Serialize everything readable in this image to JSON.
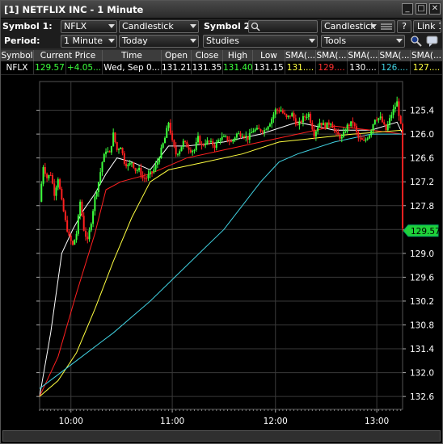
{
  "window": {
    "title": "[1] NETFLIX INC - 1 Minute",
    "buttons": [
      "_",
      "□",
      "✕"
    ]
  },
  "toolbar1": {
    "symbol1_label": "Symbol 1:",
    "symbol1_value": "NFLX",
    "chart_type": "Candlestick",
    "symbol2_label": "Symbol 2:",
    "symbol2_value": "",
    "chart_type2": "Candlestick",
    "help": "?",
    "link": "Link 1"
  },
  "toolbar2": {
    "period_label": "Period:",
    "period_value": "1 Minute",
    "range_value": "Today",
    "studies": "Studies",
    "tools": "Tools"
  },
  "quote_table": {
    "headers": [
      "Symbol",
      "Current Price",
      "Time",
      "Open",
      "Close",
      "High",
      "Low",
      "SMA(...",
      "SMA(...",
      "SMA(...",
      "SMA(...",
      "SMA(..."
    ],
    "row": [
      "NFLX",
      "129.57",
      "+4.05...",
      "Wed, Sep 0...",
      "131.21",
      "131.35",
      "131.40",
      "131.15",
      "131....",
      "129....",
      "130....",
      "126....",
      "127...."
    ],
    "colors": {
      "price": "#3cff3c",
      "high": "#3cff3c",
      "sma1": "#ffff40",
      "sma2": "#ff3030",
      "sma3": "#ffffff",
      "sma4": "#40d0e0",
      "sma5": "#ffff40"
    }
  },
  "chart": {
    "y_ticks": [
      "132.6",
      "132.0",
      "131.4",
      "130.8",
      "130.2",
      "129.6",
      "129.0",
      "128.4",
      "127.8",
      "127.2",
      "126.6",
      "126.0",
      "125.4"
    ],
    "x_ticks": [
      "10:00",
      "11:00",
      "12:00",
      "13:00"
    ],
    "last_price_label": "129.57",
    "colors": {
      "up": "#3cff3c",
      "down": "#ff2020",
      "grid": "#3a3a3a",
      "sma_white": "#ffffff",
      "sma_yellow": "#ffff40",
      "sma_red": "#ff2020",
      "sma_cyan": "#40d0e0"
    }
  },
  "chart_data": {
    "type": "candlestick",
    "title": "",
    "xlabel": "",
    "ylabel": "",
    "ylim": [
      125.2,
      133.2
    ],
    "x_ticks": [
      "10:00",
      "11:00",
      "12:00",
      "13:00"
    ],
    "y_ticks": [
      125.4,
      126.0,
      126.6,
      127.2,
      127.8,
      128.4,
      129.0,
      129.6,
      130.2,
      130.8,
      131.4,
      132.0,
      132.6
    ],
    "last_price": 129.57,
    "price_path": [
      [
        0,
        130.3
      ],
      [
        2,
        131.2
      ],
      [
        4,
        130.9
      ],
      [
        6,
        131.0
      ],
      [
        8,
        130.5
      ],
      [
        10,
        130.9
      ],
      [
        12,
        130.3
      ],
      [
        14,
        129.8
      ],
      [
        16,
        129.4
      ],
      [
        18,
        129.2
      ],
      [
        20,
        129.5
      ],
      [
        22,
        130.3
      ],
      [
        24,
        129.6
      ],
      [
        26,
        129.3
      ],
      [
        28,
        129.8
      ],
      [
        30,
        130.4
      ],
      [
        32,
        130.8
      ],
      [
        34,
        131.3
      ],
      [
        36,
        131.6
      ],
      [
        38,
        131.5
      ],
      [
        40,
        132.0
      ],
      [
        42,
        131.6
      ],
      [
        44,
        131.7
      ],
      [
        46,
        131.3
      ],
      [
        48,
        131.2
      ],
      [
        50,
        131.3
      ],
      [
        52,
        131.1
      ],
      [
        54,
        131.1
      ],
      [
        56,
        130.9
      ],
      [
        58,
        130.9
      ],
      [
        60,
        131.0
      ],
      [
        62,
        131.1
      ],
      [
        64,
        131.3
      ],
      [
        66,
        131.6
      ],
      [
        68,
        131.9
      ],
      [
        70,
        132.3
      ],
      [
        72,
        131.8
      ],
      [
        74,
        131.5
      ],
      [
        76,
        131.6
      ],
      [
        78,
        131.8
      ],
      [
        80,
        131.7
      ],
      [
        82,
        131.6
      ],
      [
        84,
        131.6
      ],
      [
        86,
        131.9
      ],
      [
        88,
        131.7
      ],
      [
        90,
        131.8
      ],
      [
        92,
        131.8
      ],
      [
        95,
        131.7
      ],
      [
        98,
        131.9
      ],
      [
        101,
        131.9
      ],
      [
        104,
        131.8
      ],
      [
        107,
        132.0
      ],
      [
        110,
        132.0
      ],
      [
        113,
        131.9
      ],
      [
        116,
        132.1
      ],
      [
        119,
        132.1
      ],
      [
        122,
        132.1
      ],
      [
        125,
        132.3
      ],
      [
        128,
        132.6
      ],
      [
        131,
        132.6
      ],
      [
        134,
        132.4
      ],
      [
        137,
        132.5
      ],
      [
        140,
        132.2
      ],
      [
        143,
        132.4
      ],
      [
        146,
        132.5
      ],
      [
        149,
        132.0
      ],
      [
        152,
        132.3
      ],
      [
        155,
        132.2
      ],
      [
        158,
        132.3
      ],
      [
        161,
        132.0
      ],
      [
        164,
        131.9
      ],
      [
        167,
        132.2
      ],
      [
        170,
        132.3
      ],
      [
        173,
        131.9
      ],
      [
        176,
        131.8
      ],
      [
        179,
        132.0
      ],
      [
        182,
        132.4
      ],
      [
        185,
        132.4
      ],
      [
        188,
        132.1
      ],
      [
        191,
        132.5
      ],
      [
        194,
        132.8
      ],
      [
        196,
        132.2
      ],
      [
        197,
        129.6
      ]
    ],
    "series": [
      {
        "name": "",
        "color": "#ffffff",
        "points": [
          [
            0,
            125.4
          ],
          [
            6,
            127.0
          ],
          [
            12,
            129.0
          ],
          [
            18,
            129.6
          ],
          [
            24,
            130.1
          ],
          [
            30,
            130.5
          ],
          [
            36,
            131.0
          ],
          [
            42,
            131.4
          ],
          [
            50,
            131.3
          ],
          [
            60,
            131.1
          ],
          [
            70,
            131.7
          ],
          [
            80,
            131.7
          ],
          [
            100,
            131.8
          ],
          [
            120,
            132.0
          ],
          [
            140,
            132.3
          ],
          [
            160,
            132.1
          ],
          [
            180,
            132.1
          ],
          [
            194,
            132.3
          ],
          [
            197,
            132.0
          ]
        ]
      },
      {
        "name": "",
        "color": "#ff2020",
        "points": [
          [
            0,
            125.4
          ],
          [
            10,
            126.4
          ],
          [
            20,
            128.0
          ],
          [
            30,
            129.5
          ],
          [
            36,
            130.6
          ],
          [
            44,
            130.8
          ],
          [
            60,
            131.0
          ],
          [
            80,
            131.4
          ],
          [
            100,
            131.6
          ],
          [
            120,
            131.8
          ],
          [
            140,
            132.0
          ],
          [
            160,
            132.2
          ],
          [
            180,
            132.1
          ],
          [
            197,
            132.0
          ]
        ]
      },
      {
        "name": "",
        "color": "#ffff40",
        "points": [
          [
            0,
            125.4
          ],
          [
            10,
            125.8
          ],
          [
            20,
            126.5
          ],
          [
            30,
            127.6
          ],
          [
            40,
            128.8
          ],
          [
            50,
            129.9
          ],
          [
            60,
            130.8
          ],
          [
            70,
            131.1
          ],
          [
            90,
            131.3
          ],
          [
            110,
            131.5
          ],
          [
            130,
            131.8
          ],
          [
            150,
            131.9
          ],
          [
            170,
            132.0
          ],
          [
            197,
            132.1
          ]
        ]
      },
      {
        "name": "",
        "color": "#40d0e0",
        "points": [
          [
            0,
            125.6
          ],
          [
            20,
            126.3
          ],
          [
            40,
            127.0
          ],
          [
            60,
            127.8
          ],
          [
            80,
            128.7
          ],
          [
            100,
            129.6
          ],
          [
            110,
            130.2
          ],
          [
            120,
            130.8
          ],
          [
            130,
            131.3
          ],
          [
            140,
            131.5
          ],
          [
            160,
            131.8
          ],
          [
            180,
            132.0
          ],
          [
            197,
            132.0
          ]
        ]
      }
    ]
  }
}
